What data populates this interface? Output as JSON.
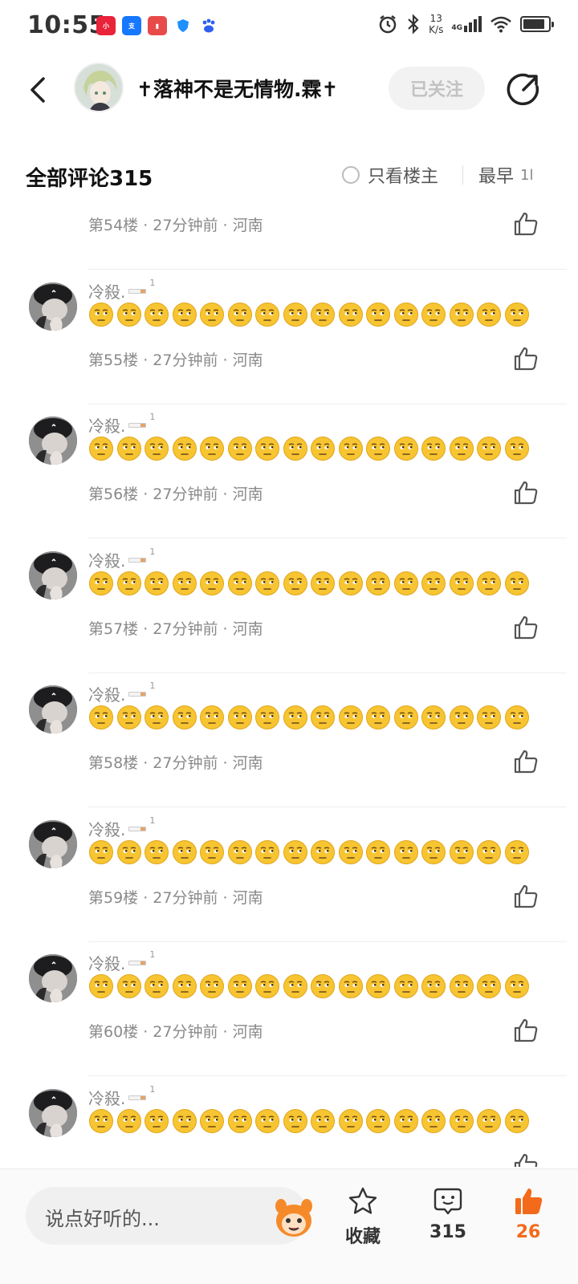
{
  "status_bar": {
    "time": "10:55",
    "net_speed_value": "13",
    "net_speed_unit": "K/s",
    "signal_label": "4G",
    "notification_icons": [
      "xiaohongshu-icon",
      "alipay-icon",
      "book-app-icon",
      "shield-app-icon",
      "baidu-icon"
    ]
  },
  "header": {
    "author_name": "✝落神不是无情物.霖✝",
    "follow_label": "已关注"
  },
  "comments_header": {
    "title": "全部评论315",
    "owner_only_label": "只看楼主",
    "sort_label": "最早",
    "sort_icon": "1l"
  },
  "comments": [
    {
      "user": "",
      "mark": "",
      "emoji_count": 16,
      "meta": "第54楼 · 27分钟前 · 河南"
    },
    {
      "user": "冷殺.",
      "mark": "1",
      "emoji_count": 16,
      "meta": "第55楼 · 27分钟前 · 河南"
    },
    {
      "user": "冷殺.",
      "mark": "1",
      "emoji_count": 16,
      "meta": "第56楼 · 27分钟前 · 河南"
    },
    {
      "user": "冷殺.",
      "mark": "1",
      "emoji_count": 16,
      "meta": "第57楼 · 27分钟前 · 河南"
    },
    {
      "user": "冷殺.",
      "mark": "1",
      "emoji_count": 16,
      "meta": "第58楼 · 27分钟前 · 河南"
    },
    {
      "user": "冷殺.",
      "mark": "1",
      "emoji_count": 16,
      "meta": "第59楼 · 27分钟前 · 河南"
    },
    {
      "user": "冷殺.",
      "mark": "1",
      "emoji_count": 16,
      "meta": "第60楼 · 27分钟前 · 河南"
    },
    {
      "user": "冷殺.",
      "mark": "1",
      "emoji_count": 16,
      "meta": ""
    }
  ],
  "bottom_bar": {
    "input_placeholder": "说点好听的...",
    "favorite_label": "收藏",
    "comment_count": "315",
    "like_count": "26"
  },
  "colors": {
    "accent": "#f36a1b",
    "meta_text": "#8a8a8a",
    "emoji_face": "#f7c531"
  }
}
